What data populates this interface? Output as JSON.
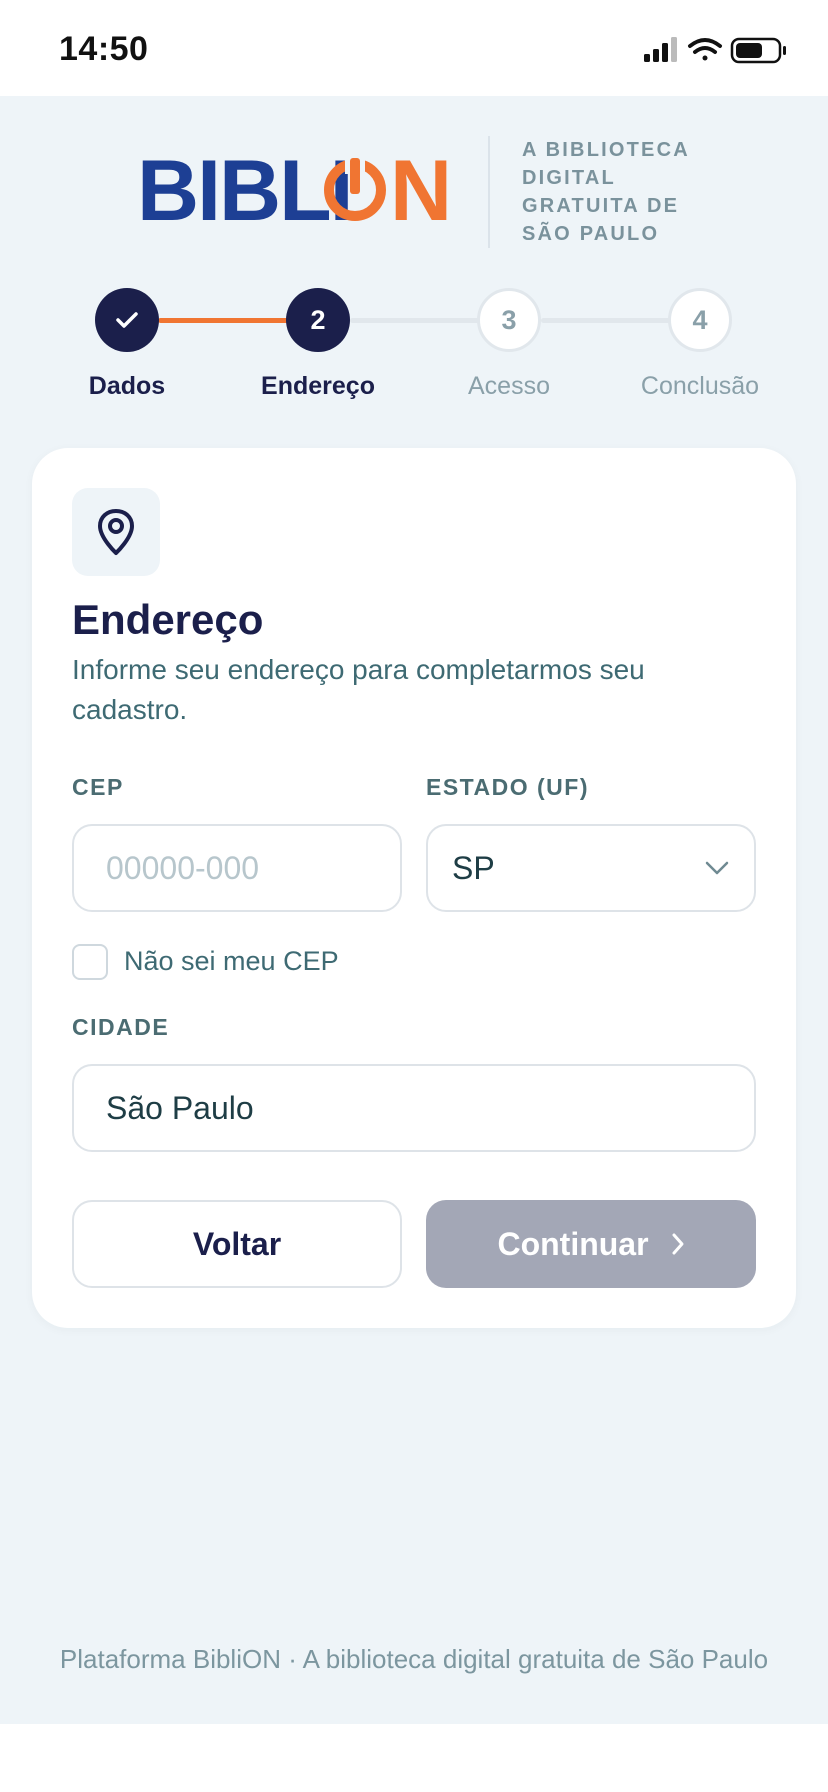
{
  "status_bar": {
    "time": "14:50"
  },
  "brand": {
    "logo_part1": "BIBLI",
    "logo_part2": "N",
    "tagline_lines": [
      "A BIBLIOTECA",
      "DIGITAL",
      "GRATUITA DE",
      "SÃO PAULO"
    ],
    "colors": {
      "navy": "#1d3f94",
      "orange": "#f07532",
      "dark": "#1b1f4b"
    }
  },
  "stepper": {
    "steps": [
      {
        "number": "",
        "label": "Dados",
        "state": "done"
      },
      {
        "number": "2",
        "label": "Endereço",
        "state": "active"
      },
      {
        "number": "3",
        "label": "Acesso",
        "state": "pending"
      },
      {
        "number": "4",
        "label": "Conclusão",
        "state": "pending"
      }
    ],
    "progress_color": "#f07532",
    "track_color": "#e1e7ec"
  },
  "card": {
    "icon": "map-pin-icon",
    "title": "Endereço",
    "subtitle": "Informe seu endereço para completarmos seu cadastro.",
    "cep": {
      "label": "CEP",
      "value": "",
      "placeholder": "00000-000"
    },
    "estado": {
      "label": "ESTADO (UF)",
      "value": "SP"
    },
    "unknown_cep": {
      "label": "Não sei meu CEP",
      "checked": false
    },
    "cidade": {
      "label": "CIDADE",
      "value": "São Paulo"
    },
    "buttons": {
      "back": "Voltar",
      "continue": "Continuar"
    }
  },
  "footer": {
    "text": "Plataforma BibliON · A biblioteca digital gratuita de São Paulo"
  }
}
